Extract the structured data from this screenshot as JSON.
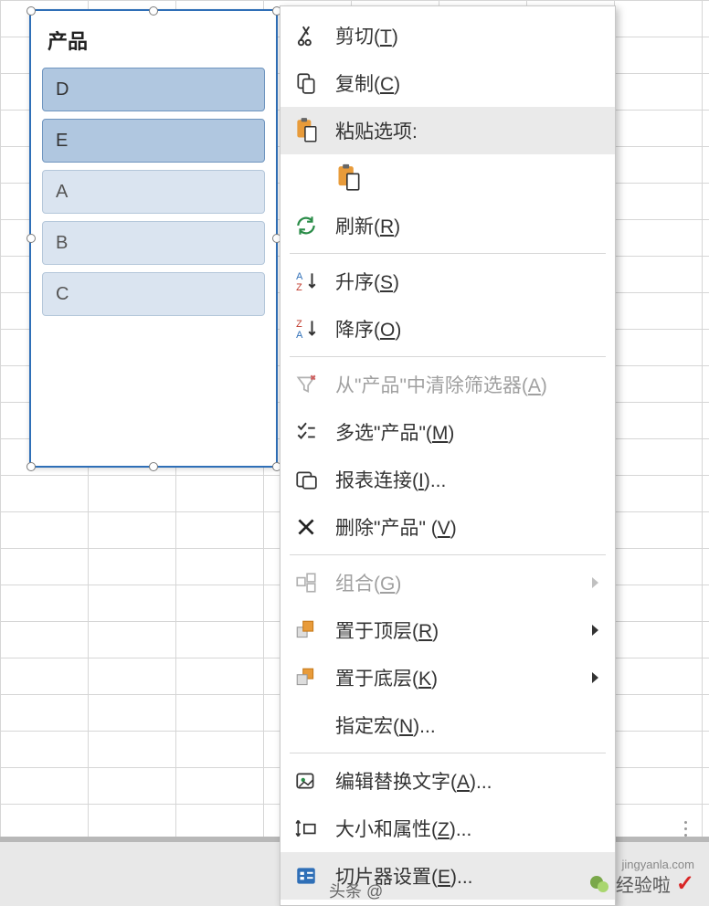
{
  "slicer": {
    "title": "产品",
    "items": [
      {
        "label": "D",
        "selected": true
      },
      {
        "label": "E",
        "selected": true
      },
      {
        "label": "A",
        "selected": false
      },
      {
        "label": "B",
        "selected": false
      },
      {
        "label": "C",
        "selected": false
      }
    ]
  },
  "menu": {
    "cut": "剪切(T)",
    "copy": "复制(C)",
    "paste_options": "粘贴选项:",
    "refresh": "刷新(R)",
    "sort_asc": "升序(S)",
    "sort_desc": "降序(O)",
    "clear_filter": "从\"产品\"中清除筛选器(A)",
    "multiselect": "多选\"产品\"(M)",
    "report_connections": "报表连接(I)...",
    "remove": "删除\"产品\" (V)",
    "group": "组合(G)",
    "bring_front": "置于顶层(R)",
    "send_back": "置于底层(K)",
    "assign_macro": "指定宏(N)...",
    "alt_text": "编辑替换文字(A)...",
    "size_props": "大小和属性(Z)...",
    "slicer_settings": "切片器设置(E)..."
  },
  "watermark": {
    "brand": "经验啦",
    "site": "jingyanla.com",
    "toutiao": "头条 @"
  }
}
